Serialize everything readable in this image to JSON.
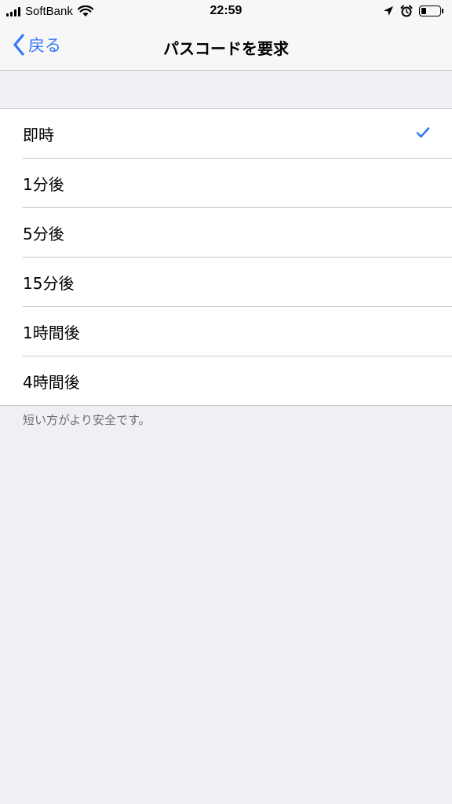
{
  "status_bar": {
    "carrier": "SoftBank",
    "time": "22:59",
    "battery_level": 0.3
  },
  "nav": {
    "back_label": "戻る",
    "title": "パスコードを要求"
  },
  "options": [
    {
      "label": "即時",
      "selected": true
    },
    {
      "label": "1分後",
      "selected": false
    },
    {
      "label": "5分後",
      "selected": false
    },
    {
      "label": "15分後",
      "selected": false
    },
    {
      "label": "1時間後",
      "selected": false
    },
    {
      "label": "4時間後",
      "selected": false
    }
  ],
  "footer_note": "短い方がより安全です。",
  "colors": {
    "accent": "#3478f6",
    "background": "#efeff4",
    "separator": "#c8c7cc"
  },
  "icons": {
    "back": "chevron-left-icon",
    "selected": "checkmark-icon",
    "wifi": "wifi-icon",
    "location": "location-arrow-icon",
    "alarm": "alarm-clock-icon",
    "battery": "battery-icon"
  }
}
